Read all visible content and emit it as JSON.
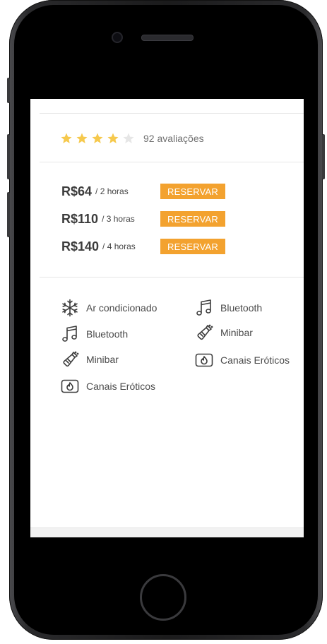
{
  "colors": {
    "accent": "#f3a22f",
    "star_filled": "#f6c94d",
    "star_empty": "#e6e6e6",
    "text_dark": "#3c3c3c",
    "text_muted": "#6f6f6f"
  },
  "rating": {
    "stars_filled": 4,
    "stars_total": 5,
    "text": "92 avaliações"
  },
  "prices": [
    {
      "amount": "R$64",
      "duration": "/ 2 horas",
      "button": "RESERVAR"
    },
    {
      "amount": "R$110",
      "duration": "/ 3 horas",
      "button": "RESERVAR"
    },
    {
      "amount": "R$140",
      "duration": "/ 4 horas",
      "button": "RESERVAR"
    }
  ],
  "amenities": {
    "left": [
      {
        "icon": "snowflake-icon",
        "label": "Ar condicionado"
      },
      {
        "icon": "music-note-icon",
        "label": "Bluetooth"
      },
      {
        "icon": "champagne-bottle-icon",
        "label": "Minibar"
      },
      {
        "icon": "flame-tv-icon",
        "label": "Canais Eróticos"
      }
    ],
    "right": [
      {
        "icon": "music-note-icon",
        "label": "Bluetooth"
      },
      {
        "icon": "champagne-bottle-icon",
        "label": "Minibar"
      },
      {
        "icon": "flame-tv-icon",
        "label": "Canais Eróticos"
      }
    ]
  }
}
